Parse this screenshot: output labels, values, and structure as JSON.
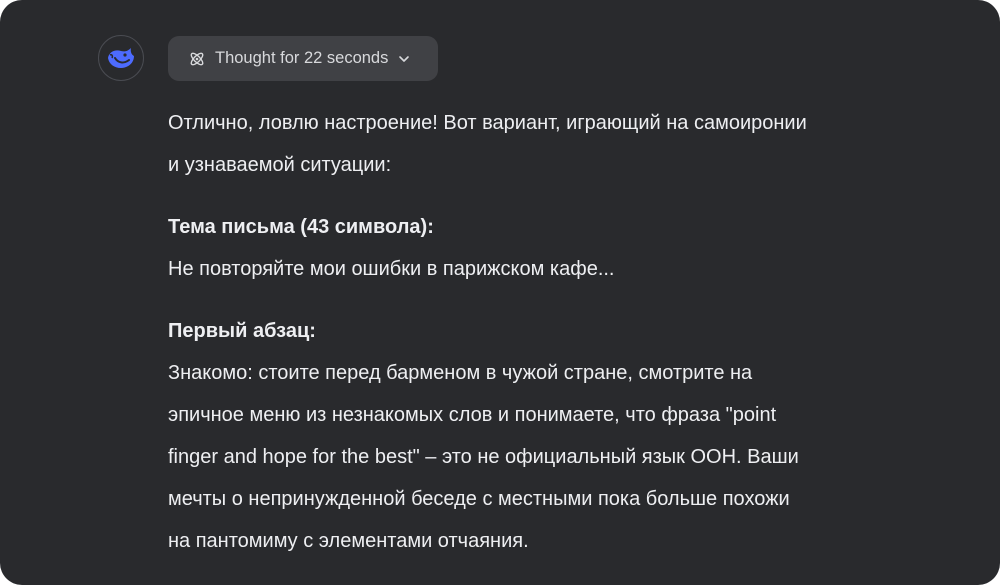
{
  "thought": {
    "label": "Thought for 22 seconds"
  },
  "message": {
    "intro_line1": "Отлично, ловлю настроение! Вот вариант, играющий на самоиронии",
    "intro_line2": "и узнаваемой ситуации:",
    "subject_heading": "Тема письма (43 символа):",
    "subject_text": "Не повторяйте мои ошибки в парижском кафе...",
    "paragraph_heading": "Первый абзац:",
    "paragraph_lines": [
      "Знакомо: стоите перед барменом в чужой стране, смотрите на",
      "эпичное меню из незнакомых слов и понимаете, что фраза \"point",
      "finger and hope for the best\" – это не официальный язык ООН. Ваши",
      "мечты о непринужденной беседе с местными пока больше похожи",
      "на пантомиму с элементами отчаяния."
    ]
  },
  "icons": {
    "avatar": "deepseek-whale-logo",
    "thought": "atom-icon",
    "expand": "chevron-down-icon"
  },
  "colors": {
    "background": "#292a2d",
    "button": "#404145",
    "text": "#eeeff2",
    "logo": "#4d6bfe"
  }
}
